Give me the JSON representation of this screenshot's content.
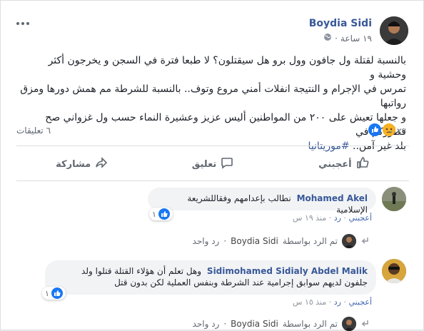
{
  "post": {
    "author": "Boydia Sidi",
    "time": "١٩ ساعة",
    "text_line1": "بالنسبة لقتلة ول جافون وول برو هل سيقتلون؟ لا طبعا فترة في السجن و يخرجون أكثر وحشية و",
    "text_line2": "تمرس في الإجرام و النتيجة انفلات أمني مروع وتوف.. بالنسبة للشرطة مم همش دورها ومزق رواتبها",
    "text_line3": "و جعلها تعيش على ٢٠٠ من المواطنين أليس عزيز وعشيرة النماء حسب ول غزواني صح فطوركم في",
    "text_line4": "بلد غير آمن..",
    "hashtag": "#موريتانيا",
    "reactions_count": "٢٧",
    "comments_count": "٦ تعليقات"
  },
  "actions": {
    "like": "أعجبني",
    "comment": "تعليق",
    "share": "مشاركة"
  },
  "comments": [
    {
      "author": "Mohamed Akel",
      "text": "نطالب بإعدامهم وفقاللشريعة الإسلامية",
      "like_label": "أعجبني",
      "reply_label": "رد",
      "time": "منذ ١٩ س",
      "likes": "١",
      "replied_by_prefix": "تم الرد بواسطة",
      "replied_by": "Boydia Sidi",
      "reply_count": "رد واحد"
    },
    {
      "author": "Sidimohamed Sidialy Abdel Malik",
      "text_line1": "وهل تعلم أن هؤلاء القتلة قتلوا ولد",
      "text_line2": "جلفون لديهم سوابق إجرامية عند الشرطة وبنفس العملية لكن بدون قتل",
      "like_label": "أعجبني",
      "reply_label": "رد",
      "time": "منذ ١٥ س",
      "likes": "١",
      "replied_by_prefix": "تم الرد بواسطة",
      "replied_by": "Boydia Sidi",
      "reply_count": "رد واحد"
    }
  ]
}
